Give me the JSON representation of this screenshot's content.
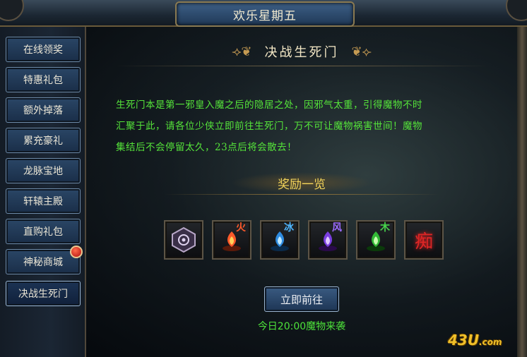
{
  "window": {
    "title": "欢乐星期五"
  },
  "sidebar": {
    "items": [
      {
        "label": "在线领奖",
        "active": false,
        "badge": false
      },
      {
        "label": "特惠礼包",
        "active": false,
        "badge": false
      },
      {
        "label": "额外掉落",
        "active": false,
        "badge": false
      },
      {
        "label": "累充豪礼",
        "active": false,
        "badge": false
      },
      {
        "label": "龙脉宝地",
        "active": false,
        "badge": false
      },
      {
        "label": "轩辕主殿",
        "active": false,
        "badge": false
      },
      {
        "label": "直购礼包",
        "active": false,
        "badge": false
      },
      {
        "label": "神秘商城",
        "active": false,
        "badge": true
      },
      {
        "label": "决战生死门",
        "active": true,
        "badge": false
      }
    ]
  },
  "main": {
    "event_title": "决战生死门",
    "description_lines": [
      "生死门本是第一邪皇入魔之后的隐居之处，因邪气太重，引得魔物不时",
      "汇聚于此，请各位少侠立即前往生死门，万不可让魔物祸害世间！魔物",
      "集结后不会停留太久，23点后将会散去！"
    ],
    "reward_heading": "奖励一览",
    "rewards": [
      {
        "icon": "emblem-icon",
        "glyph": "",
        "color": "#b8a7c8"
      },
      {
        "icon": "fire-gem-icon",
        "glyph": "火",
        "color": "#ff5a2a"
      },
      {
        "icon": "ice-gem-icon",
        "glyph": "冰",
        "color": "#4fb6ff"
      },
      {
        "icon": "wind-gem-icon",
        "glyph": "风",
        "color": "#9d6bff"
      },
      {
        "icon": "wood-gem-icon",
        "glyph": "木",
        "color": "#46d44a"
      },
      {
        "icon": "rune-icon",
        "glyph": "痴",
        "color": "#e02626"
      }
    ],
    "go_button": "立即前往",
    "notice": "今日20:00魔物来袭"
  },
  "watermark": {
    "logo_main": "43U",
    "logo_suffix": ".com"
  }
}
